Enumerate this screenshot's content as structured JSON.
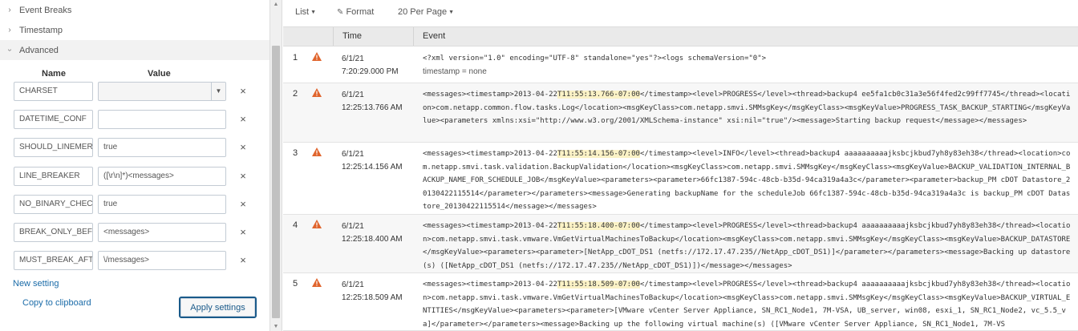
{
  "sections": {
    "event_breaks": "Event Breaks",
    "timestamp": "Timestamp",
    "advanced": "Advanced"
  },
  "settings_table": {
    "col_name": "Name",
    "col_value": "Value",
    "rows": [
      {
        "name": "CHARSET",
        "value": ""
      },
      {
        "name": "DATETIME_CONF",
        "value": ""
      },
      {
        "name": "SHOULD_LINEMERGE",
        "value": "true"
      },
      {
        "name": "LINE_BREAKER",
        "value": "([\\r\\n]*)<messages>"
      },
      {
        "name": "NO_BINARY_CHECK",
        "value": "true"
      },
      {
        "name": "BREAK_ONLY_BEFORE",
        "value": "<messages>"
      },
      {
        "name": "MUST_BREAK_AFTER",
        "value": "\\/messages>"
      }
    ],
    "remove_glyph": "×"
  },
  "actions": {
    "new_setting": "New setting",
    "copy": "Copy to clipboard",
    "apply": "Apply settings"
  },
  "toolbar": {
    "list": "List",
    "format": "Format",
    "per_page": "20 Per Page"
  },
  "events_table": {
    "col_time": "Time",
    "col_event": "Event",
    "rows": [
      {
        "num": "1",
        "date": "6/1/21",
        "time": "7:20:29.000 PM",
        "pre": "<?xml version=\"1.0\" encoding=\"UTF-8\" standalone=\"yes\"?><logs schemaVersion=\"0\">",
        "hl": "",
        "post": "",
        "meta": "timestamp = none"
      },
      {
        "num": "2",
        "date": "6/1/21",
        "time": "12:25:13.766 AM",
        "pre": "<messages><timestamp>2013-04-22",
        "hl": "T11:55:13.766-07:00",
        "post": "</timestamp><level>PROGRESS</level><thread>backup4 ee5fa1cb0c31a3e56f4fed2c99ff7745</thread><location>com.netapp.common.flow.tasks.Log</location><msgKeyClass>com.netapp.smvi.SMMsgKey</msgKeyClass><msgKeyValue>PROGRESS_TASK_BACKUP_STARTING</msgKeyValue><parameters xmlns:xsi=\"http://www.w3.org/2001/XMLSchema-instance\" xsi:nil=\"true\"/><message>Starting backup request</message></messages>",
        "meta": ""
      },
      {
        "num": "3",
        "date": "6/1/21",
        "time": "12:25:14.156 AM",
        "pre": "<messages><timestamp>2013-04-22",
        "hl": "T11:55:14.156-07:00",
        "post": "</timestamp><level>INFO</level><thread>backup4 aaaaaaaaaajksbcjkbud7yh8y83eh38</thread><location>com.netapp.smvi.task.validation.BackupValidation</location><msgKeyClass>com.netapp.smvi.SMMsgKey</msgKeyClass><msgKeyValue>BACKUP_VALIDATION_INTERNAL_BACKUP_NAME_FOR_SCHEDULE_JOB</msgKeyValue><parameters><parameter>66fc1387-594c-48cb-b35d-94ca319a4a3c</parameter><parameter>backup_PM cDOT Datastore_20130422115514</parameter></parameters><message>Generating backupName for the scheduleJob 66fc1387-594c-48cb-b35d-94ca319a4a3c is backup_PM cDOT Datastore_20130422115514</message></messages>",
        "meta": ""
      },
      {
        "num": "4",
        "date": "6/1/21",
        "time": "12:25:18.400 AM",
        "pre": "<messages><timestamp>2013-04-22",
        "hl": "T11:55:18.400-07:00",
        "post": "</timestamp><level>PROGRESS</level><thread>backup4 aaaaaaaaaajksbcjkbud7yh8y83eh38</thread><location>com.netapp.smvi.task.vmware.VmGetVirtualMachinesToBackup</location><msgKeyClass>com.netapp.smvi.SMMsgKey</msgKeyClass><msgKeyValue>BACKUP_DATASTORE</msgKeyValue><parameters><parameter>[NetApp_cDOT_DS1 (netfs://172.17.47.235//NetApp_cDOT_DS1)]</parameter></parameters><message>Backing up datastore(s) ([NetApp_cDOT_DS1 (netfs://172.17.47.235//NetApp_cDOT_DS1)])</message></messages>",
        "meta": ""
      },
      {
        "num": "5",
        "date": "6/1/21",
        "time": "12:25:18.509 AM",
        "pre": "<messages><timestamp>2013-04-22",
        "hl": "T11:55:18.509-07:00",
        "post": "</timestamp><level>PROGRESS</level><thread>backup4 aaaaaaaaaajksbcjkbud7yh8y83eh38</thread><location>com.netapp.smvi.task.vmware.VmGetVirtualMachinesToBackup</location><msgKeyClass>com.netapp.smvi.SMMsgKey</msgKeyClass><msgKeyValue>BACKUP_VIRTUAL_ENTITIES</msgKeyValue><parameters><parameter>[VMware vCenter Server Appliance, SN_RC1_Node1, 7M-VSA, UB_server, win08, esxi_1, SN_RC1_Node2, vc_5.5_va]</parameter></parameters><message>Backing up the following virtual machine(s) ([VMware vCenter Server Appliance, SN_RC1_Node1, 7M-VS",
        "meta": ""
      }
    ]
  },
  "colors": {
    "accent": "#1a6ba8",
    "warning": "#e0642c",
    "highlight": "#fbf2c6"
  }
}
